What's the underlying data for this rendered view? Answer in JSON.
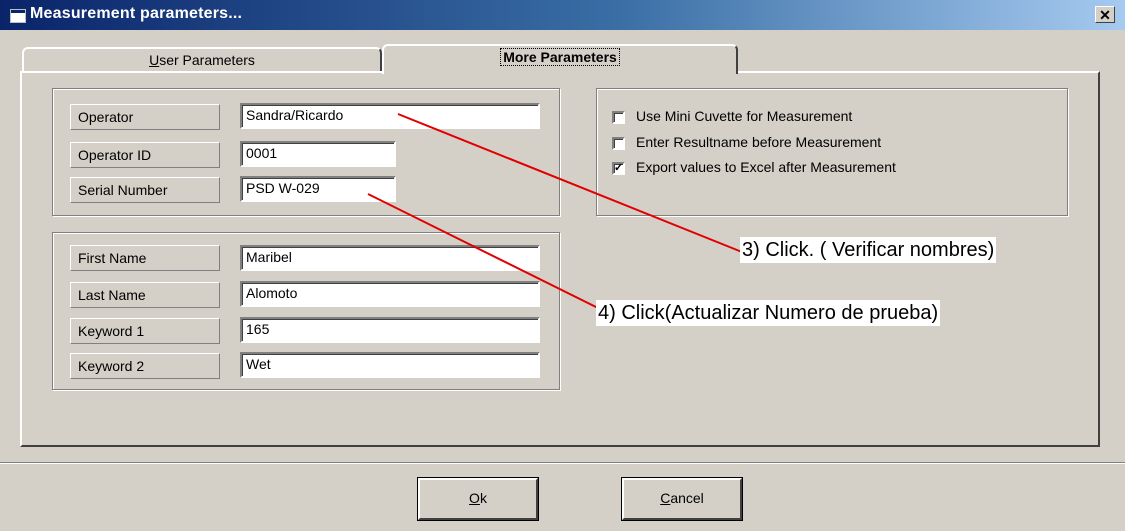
{
  "window": {
    "title": "Measurement parameters...",
    "close_symbol": "✕"
  },
  "tabs": [
    {
      "label": "User Parameters",
      "mnemonic": "U",
      "rest": "ser Parameters",
      "active": false
    },
    {
      "label": "More Parameters",
      "active": true
    }
  ],
  "operator_group": {
    "fields": [
      {
        "label": "Operator",
        "value": "Sandra/Ricardo"
      },
      {
        "label": "Operator ID",
        "value": "0001"
      },
      {
        "label": "Serial Number",
        "value": "PSD W-029"
      }
    ]
  },
  "person_group": {
    "fields": [
      {
        "label": "First Name",
        "value": "Maribel"
      },
      {
        "label": "Last Name",
        "value": "Alomoto"
      },
      {
        "label": "Keyword 1",
        "value": "165"
      },
      {
        "label": "Keyword 2",
        "value": "Wet"
      }
    ]
  },
  "options": [
    {
      "label": "Use Mini Cuvette for Measurement",
      "checked": false
    },
    {
      "label": "Enter Resultname before Measurement",
      "checked": false
    },
    {
      "label": "Export values to Excel after Measurement",
      "checked": true
    }
  ],
  "check_mark": "✓",
  "buttons": {
    "ok": {
      "mnemonic": "O",
      "rest": "k"
    },
    "cancel": {
      "mnemonic": "C",
      "rest": "ancel"
    }
  },
  "annotations": {
    "note3": "3) Click. ( Verificar nombres)",
    "note4": "4) Click(Actualizar Numero de prueba)",
    "arrow_color": "#e00000"
  },
  "colors": {
    "face": "#d4d0c8",
    "title_start": "#0a246a",
    "title_end": "#a6caf0"
  }
}
